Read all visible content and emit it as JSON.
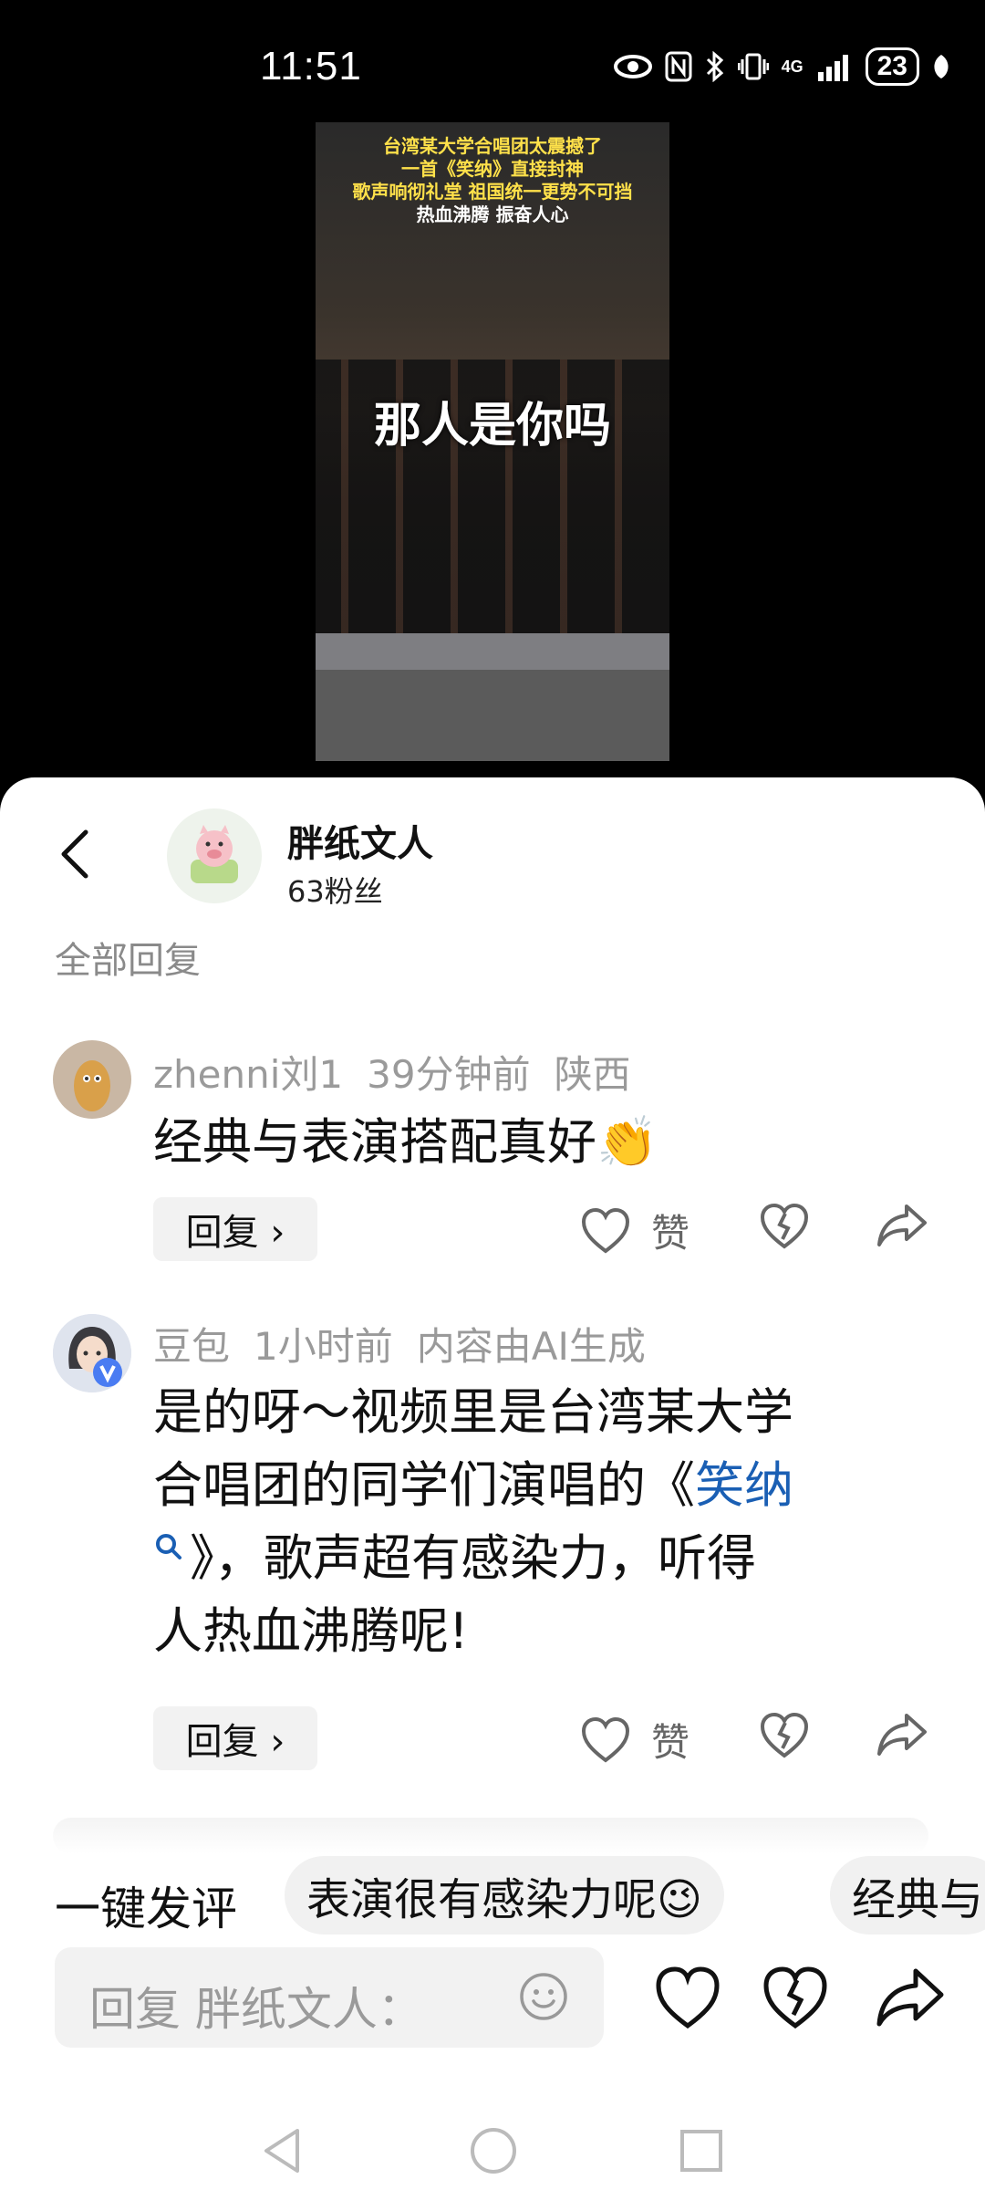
{
  "status_bar": {
    "time": "11:51",
    "network": "4G",
    "battery": "23"
  },
  "video": {
    "caption_line1": "台湾某大学合唱团太震撼了",
    "caption_line2": "一首《笑纳》直接封神",
    "caption_line3": "歌声响彻礼堂 祖国统一更势不可挡",
    "caption_line4": "热血沸腾 振奋人心",
    "overlay_text": "那人是你吗"
  },
  "header": {
    "author_name": "胖纸文人",
    "fans": "63粉丝"
  },
  "section_title": "全部回复",
  "comments": [
    {
      "user": "zhenni刘1",
      "time": "39分钟前",
      "location": "陕西",
      "text": "经典与表演搭配真好👏",
      "reply_label": "回复 ›",
      "like_label": "赞"
    },
    {
      "user": "豆包",
      "time": "1小时前",
      "note": "内容由AI生成",
      "text_line1": "是的呀～视频里是台湾某大学",
      "text_line2_before": "合唱团的同学们演唱的《",
      "text_link": "笑纳",
      "text_line3": "》，歌声超有感染力，听得",
      "text_line4": "人热血沸腾呢!",
      "reply_label": "回复 ›",
      "like_label": "赞"
    }
  ],
  "quick_comment": {
    "label": "一键发评",
    "chips": [
      "表演很有感染力呢😉",
      "经典与"
    ]
  },
  "input": {
    "placeholder": "回复 胖纸文人："
  },
  "icons": {
    "back": "back-arrow-icon",
    "like": "heart-icon",
    "dislike": "broken-heart-icon",
    "share": "share-arrow-icon",
    "emoji": "smiley-icon",
    "search": "search-icon"
  },
  "colors": {
    "link": "#1a5fb4",
    "meta": "#9a9a9a",
    "chip_bg": "#f1f1f1"
  }
}
